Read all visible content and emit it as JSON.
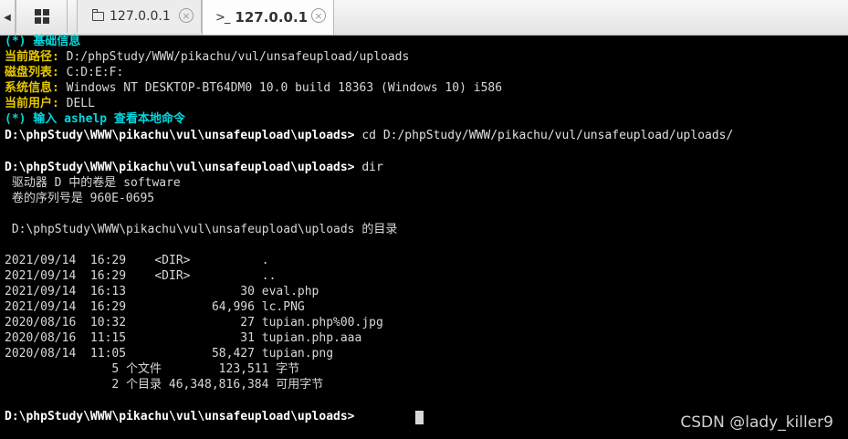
{
  "tabs": {
    "nav_left_icon": "chevron-left-icon",
    "grid_icon": "grid-icon",
    "folder_tab_label": "127.0.0.1",
    "terminal_tab_label": "127.0.0.1",
    "terminal_icon_glyph": ">_",
    "close_glyph": "×"
  },
  "info": {
    "header": "(*) 基础信息",
    "path_key": "当前路径:",
    "path_val": " D:/phpStudy/WWW/pikachu/vul/unsafeupload/uploads",
    "disk_key": "磁盘列表:",
    "disk_val": " C:D:E:F:",
    "sys_key": "系统信息:",
    "sys_val": " Windows NT DESKTOP-BT64DM0 10.0 build 18363 (Windows 10) i586",
    "user_key": "当前用户:",
    "user_val": " DELL",
    "hint": "(*) 输入 ashelp 查看本地命令"
  },
  "session": {
    "prompt": "D:\\phpStudy\\WWW\\pikachu\\vul\\unsafeupload\\uploads>",
    "cmd1": " cd D:/phpStudy/WWW/pikachu/vul/unsafeupload/uploads/",
    "cmd2": " dir",
    "vol_line": " 驱动器 D 中的卷是 software",
    "serial_line": " 卷的序列号是 960E-0695",
    "dir_of_line": " D:\\phpStudy\\WWW\\pikachu\\vul\\unsafeupload\\uploads 的目录",
    "entries": [
      "2021/09/14  16:29    <DIR>          .",
      "2021/09/14  16:29    <DIR>          ..",
      "2021/09/14  16:13                30 eval.php",
      "2021/09/14  16:29            64,996 lc.PNG",
      "2020/08/16  10:32                27 tupian.php%00.jpg",
      "2020/08/16  11:15                31 tupian.php.aaa",
      "2020/08/14  11:05            58,427 tupian.png"
    ],
    "files_summary": "               5 个文件        123,511 字节",
    "dirs_summary": "               2 个目录 46,348,816,384 可用字节"
  },
  "watermark": "CSDN @lady_killer9",
  "colors": {
    "background": "#000000",
    "info_header": "#00d8e0",
    "info_key": "#e6c700",
    "text": "#d8d8d8"
  }
}
